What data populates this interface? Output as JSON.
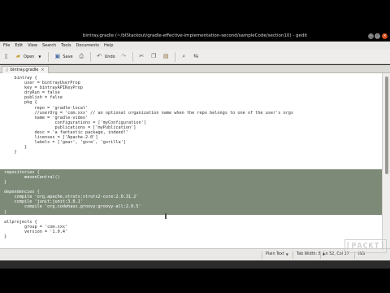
{
  "window": {
    "title": "bintray.gradle (~/blStackout/gradle-effective-implementation-second/sampleCode/section10) - gedit"
  },
  "menu": [
    "File",
    "Edit",
    "View",
    "Search",
    "Tools",
    "Documents",
    "Help"
  ],
  "toolbar": {
    "open_label": "Open",
    "save_label": "Save",
    "undo_label": "Undo"
  },
  "tab": {
    "label": "bintray.gradle"
  },
  "code_lines": [
    "    bintray {",
    "        user = bintrayUserProp",
    "        key = bintrayAPIKeyProp",
    "        dryRun = false",
    "        publish = false",
    "        pkg {",
    "            repo = 'gradle-local'",
    "            //userOrg = 'com.xxx' // an optional organization name when the repo belongs to one of the user's orgs",
    "            name = 'gradle-video'",
    "                    configurations = ['myConfiguration']",
    "                    publications = ['myPublication']",
    "            desc = 'a fantastic package, indeed!'",
    "            licenses = ['Apache-2.0']",
    "            labels = ['gear', 'gore', 'gorilla']",
    "        }",
    "    }",
    "",
    "",
    "",
    "repositories {",
    "        mavenCentral()",
    "}",
    "",
    "dependencies {",
    "    compile 'org.apache.struts:struts2-core:2.0.31.2'",
    "    compile 'junit:junit:3.8.1'",
    "        compile 'org.codehaus.groovy:groovy-all:2.0.5'",
    "}",
    "",
    "allprojects {",
    "        group = 'com.xxx'",
    "        version = '1.0.4'",
    "}"
  ],
  "selected_line_range": [
    19,
    27
  ],
  "status": {
    "language": "Plain Text",
    "tab_width": "Tab Width: 8",
    "position": "Ln 52, Col 37",
    "mode": "INS"
  },
  "watermark": "PACKT"
}
